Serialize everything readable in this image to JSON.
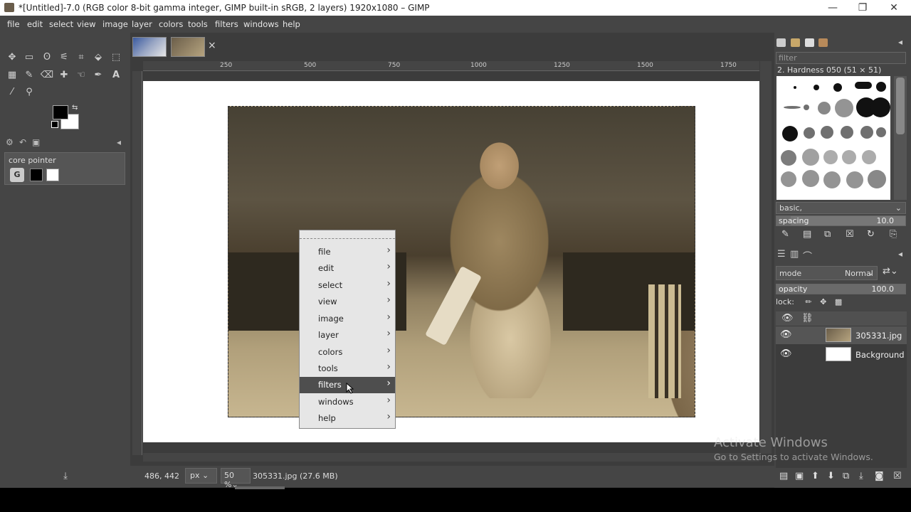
{
  "window": {
    "title": "*[Untitled]-7.0 (RGB color 8-bit gamma integer, GIMP built-in sRGB, 2 layers) 1920x1080 – GIMP",
    "min": "—",
    "max": "❐",
    "close": "✕"
  },
  "menubar": [
    "file",
    "edit",
    "select",
    "view",
    "image",
    "layer",
    "colors",
    "tools",
    "filters",
    "windows",
    "help"
  ],
  "tab_close": "×",
  "toolbox": {
    "tools": [
      "move-tool",
      "rect-select",
      "free-select",
      "fuzzy-select",
      "crop",
      "transform",
      "warp",
      "gradient",
      "paintbrush",
      "eraser",
      "heal",
      "smudge",
      "paths",
      "text",
      "color-picker",
      "zoom"
    ]
  },
  "device_panel": {
    "label": "core pointer",
    "g": "G"
  },
  "ruler_marks": [
    "250",
    "500",
    "750",
    "1000",
    "1250",
    "1500",
    "1750"
  ],
  "context_menu": {
    "items": [
      "file",
      "edit",
      "select",
      "view",
      "image",
      "layer",
      "colors",
      "tools",
      "filters",
      "windows",
      "help"
    ],
    "selected": "filters"
  },
  "status": {
    "coords": "486, 442",
    "unit": "px",
    "zoom": "50 %",
    "file": "305331.jpg (27.6 MB)"
  },
  "brushes": {
    "filter_placeholder": "filter",
    "current": "2. Hardness 050 (51 × 51)",
    "tag": "basic,",
    "spacing_label": "spacing",
    "spacing_value": "10.0"
  },
  "layers": {
    "mode_label": "mode",
    "mode_value": "Normal",
    "opacity_label": "opacity",
    "opacity_value": "100.0",
    "lock_label": "lock:",
    "items": [
      {
        "name": "305331.jpg",
        "selected": true
      },
      {
        "name": "Background",
        "selected": false
      }
    ]
  },
  "watermark": {
    "title": "Activate Windows",
    "sub": "Go to Settings to activate Windows."
  },
  "colors": {
    "accent": "#4e4e4e",
    "bg": "#454545"
  }
}
